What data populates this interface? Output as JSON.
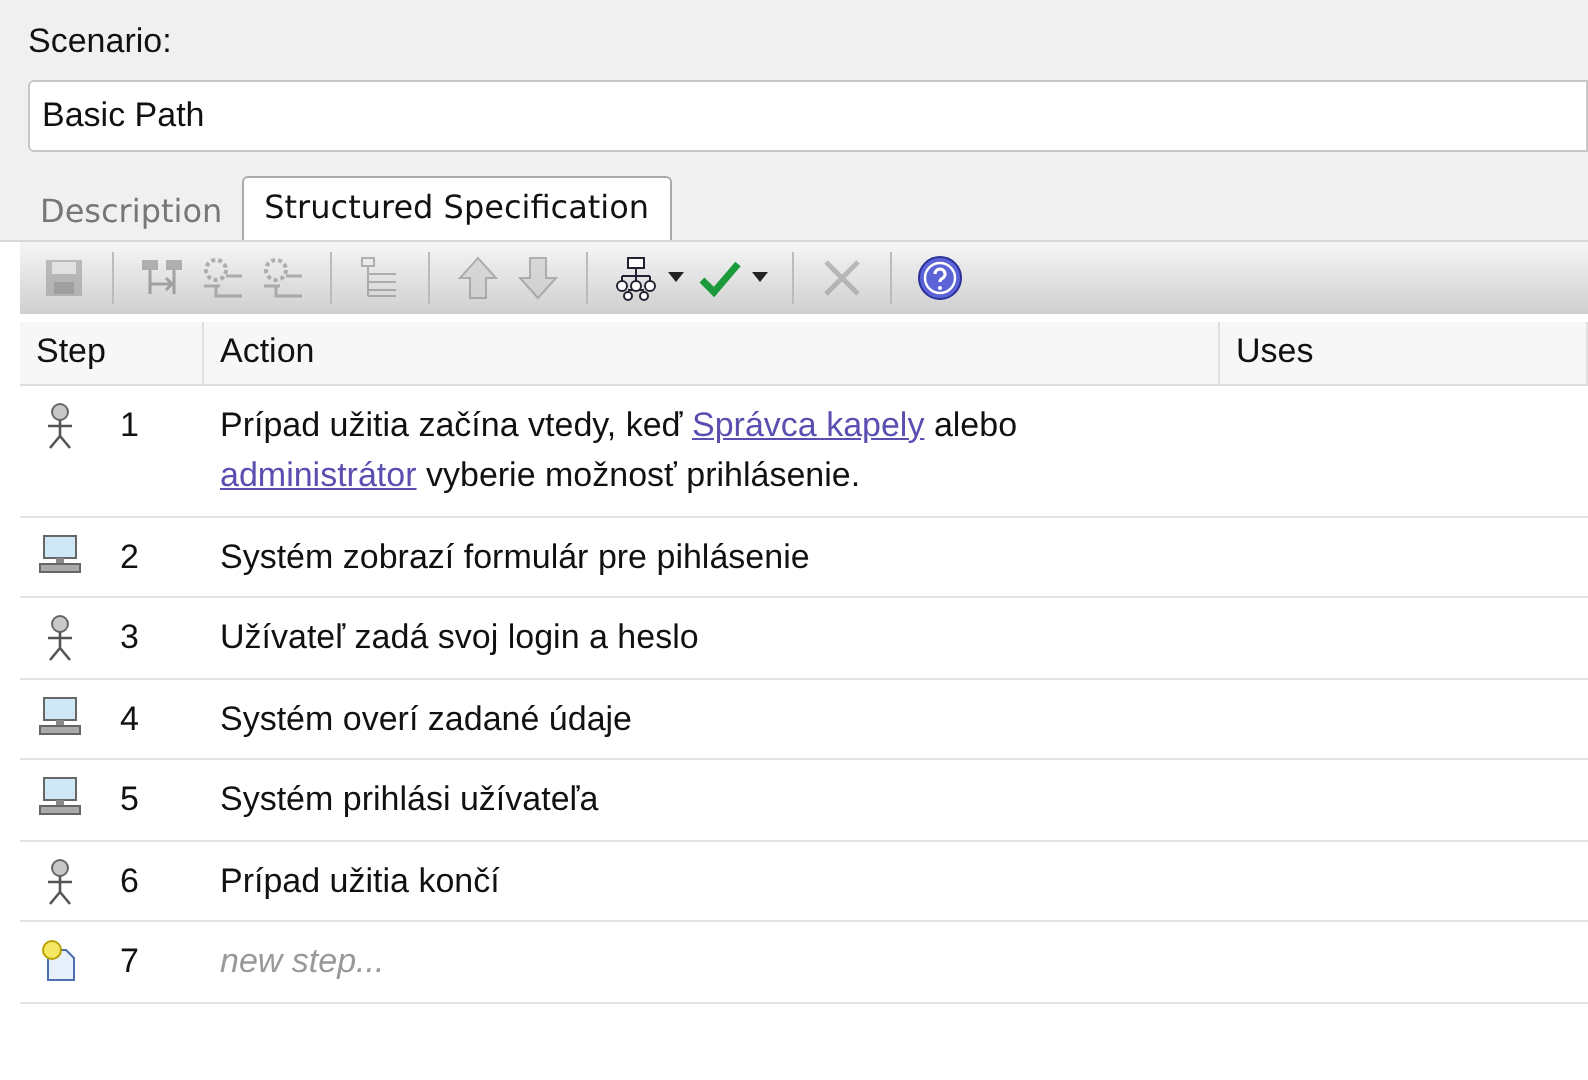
{
  "scenario": {
    "label": "Scenario:",
    "value": "Basic Path"
  },
  "tabs": [
    {
      "label": "Description",
      "selected": false
    },
    {
      "label": "Structured Specification",
      "selected": true
    }
  ],
  "toolbar": [
    {
      "kind": "save",
      "disabled": true
    },
    {
      "kind": "sep"
    },
    {
      "kind": "split",
      "disabled": true
    },
    {
      "kind": "gear",
      "disabled": true
    },
    {
      "kind": "gear",
      "disabled": true
    },
    {
      "kind": "sep"
    },
    {
      "kind": "tree",
      "disabled": true
    },
    {
      "kind": "sep"
    },
    {
      "kind": "up",
      "disabled": true
    },
    {
      "kind": "down",
      "disabled": true
    },
    {
      "kind": "sep"
    },
    {
      "kind": "hierarchy",
      "disabled": false,
      "dropdown": true
    },
    {
      "kind": "check",
      "disabled": false,
      "dropdown": true
    },
    {
      "kind": "sep"
    },
    {
      "kind": "delete",
      "disabled": true
    },
    {
      "kind": "sep"
    },
    {
      "kind": "help",
      "disabled": false
    }
  ],
  "table": {
    "columns": [
      "Step",
      "Action",
      "Uses"
    ],
    "rows": [
      {
        "kind": "actor",
        "step": "1",
        "action": [
          {
            "kind": "text",
            "text": "Prípad užitia začína vtedy, keď "
          },
          {
            "kind": "link",
            "text": "Správca kapely"
          },
          {
            "kind": "text",
            "text": " alebo "
          },
          {
            "kind": "link",
            "text": "administrátor"
          },
          {
            "kind": "text",
            "text": " vyberie možnosť prihlásenie."
          }
        ]
      },
      {
        "kind": "system",
        "step": "2",
        "action": [
          {
            "kind": "text",
            "text": "Systém zobrazí formulár pre pihlásenie"
          }
        ]
      },
      {
        "kind": "actor",
        "step": "3",
        "action": [
          {
            "kind": "text",
            "text": "Užívateľ zadá svoj login a heslo"
          }
        ]
      },
      {
        "kind": "system",
        "step": "4",
        "action": [
          {
            "kind": "text",
            "text": "Systém overí zadané údaje"
          }
        ]
      },
      {
        "kind": "system",
        "step": "5",
        "action": [
          {
            "kind": "text",
            "text": "Systém prihlási užívateľa"
          }
        ]
      },
      {
        "kind": "actor",
        "step": "6",
        "action": [
          {
            "kind": "text",
            "text": "Prípad užitia končí"
          }
        ]
      },
      {
        "kind": "new",
        "step": "7",
        "action": [
          {
            "kind": "text",
            "text": "new step..."
          }
        ]
      }
    ]
  }
}
